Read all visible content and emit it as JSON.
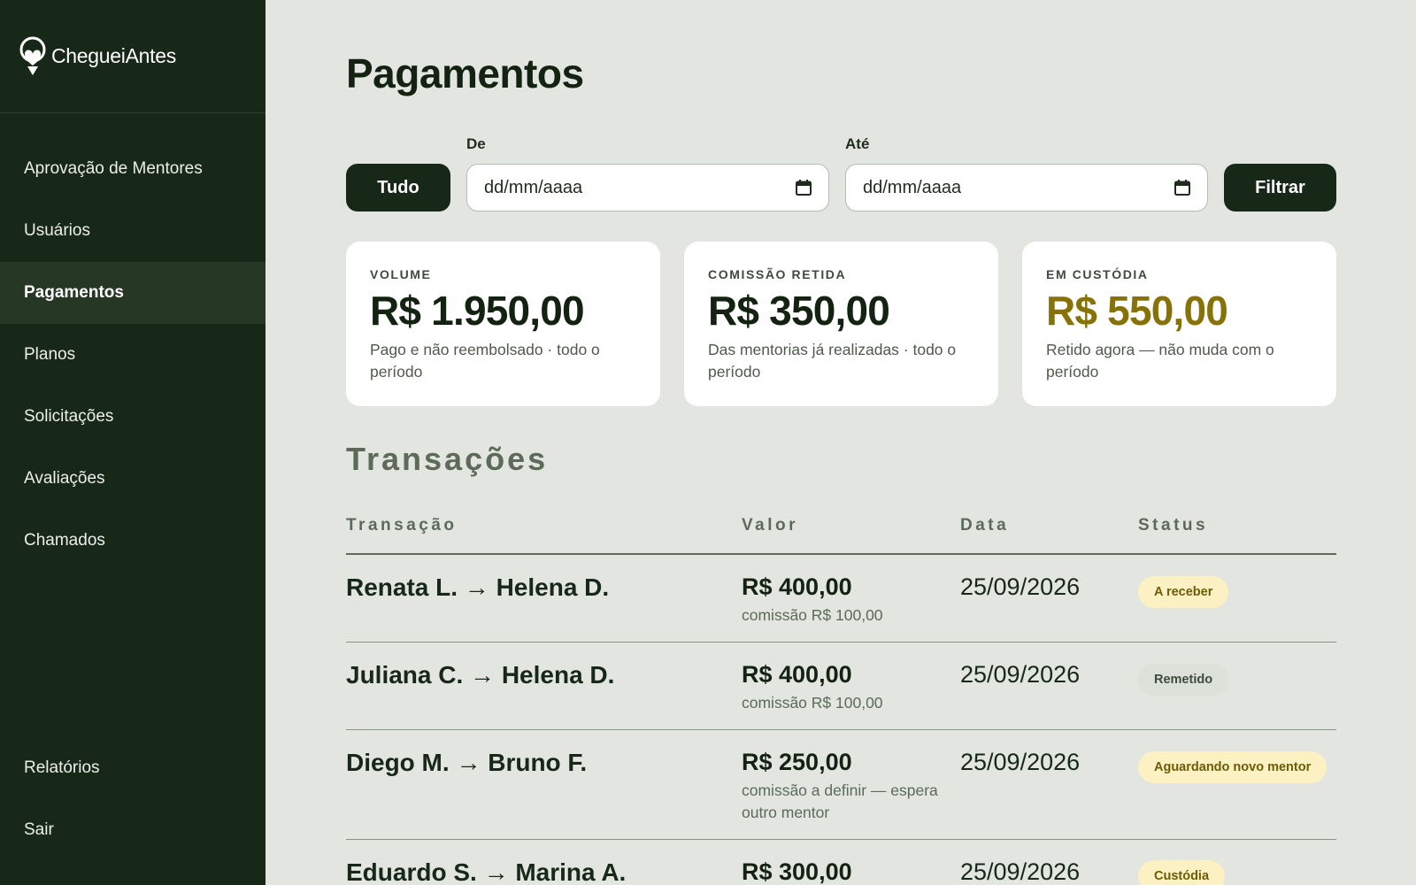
{
  "brand": {
    "name": "CheguеiAntes",
    "logo_icon": "person-heart-icon"
  },
  "sidebar": {
    "items": [
      {
        "label": "Aprovação de Mentores"
      },
      {
        "label": "Usuários"
      },
      {
        "label": "Pagamentos",
        "active": true
      },
      {
        "label": "Planos"
      },
      {
        "label": "Solicitações"
      },
      {
        "label": "Avaliações"
      },
      {
        "label": "Chamados"
      }
    ],
    "bottom_items": [
      {
        "label": "Relatórios"
      },
      {
        "label": "Sair"
      }
    ]
  },
  "page": {
    "title": "Pagamentos"
  },
  "filters": {
    "all_label": "Tudo",
    "from_label": "De",
    "from_placeholder": "dd/mm/aaaa",
    "to_label": "Até",
    "to_placeholder": "dd/mm/aaaa",
    "filter_label": "Filtrar",
    "calendar_icon": "calendar-icon"
  },
  "summary": [
    {
      "label": "VOLUME",
      "value": "R$ 1.950,00",
      "sub": "Pago e não reembolsado · todo o período"
    },
    {
      "label": "COMISSÃO RETIDA",
      "value": "R$ 350,00",
      "sub": "Das mentorias já realizadas · todo o período"
    },
    {
      "label": "EM CUSTÓDIA",
      "value": "R$ 550,00",
      "sub": "Retido agora — não muda com o período"
    }
  ],
  "transactions": {
    "title": "Transações",
    "headers": {
      "transaction": "Transação",
      "value": "Valor",
      "date": "Data",
      "status": "Status"
    },
    "rows": [
      {
        "name": "Renata L. → Helena D.",
        "value": "R$ 400,00",
        "commission": "comissão R$ 100,00",
        "date": "25/09/2026",
        "status": "A receber"
      },
      {
        "name": "Juliana C. → Helena D.",
        "value": "R$ 400,00",
        "commission": "comissão R$ 100,00",
        "date": "25/09/2026",
        "status": "Remetido"
      },
      {
        "name": "Diego M. → Bruno F.",
        "value": "R$ 250,00",
        "commission": "comissão a definir — espera outro mentor",
        "date": "25/09/2026",
        "status": "Aguardando novo mentor"
      },
      {
        "name": "Eduardo S. → Marina A.",
        "value": "R$ 300,00",
        "commission": "",
        "date": "25/09/2026",
        "status": "Custódia"
      }
    ]
  },
  "colors": {
    "sidebar": "#182818",
    "accent_gold": "#877208",
    "badge_yellow": "#fbf1c2",
    "background": "#e2e5e0"
  }
}
